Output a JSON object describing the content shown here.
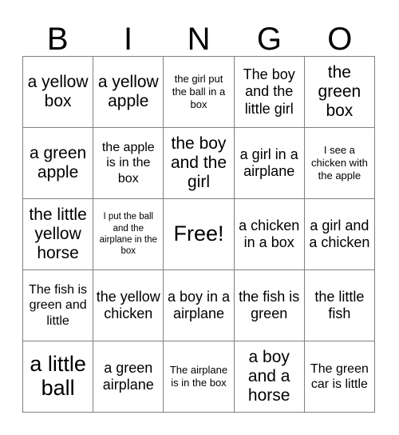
{
  "header": {
    "letters": [
      "B",
      "I",
      "N",
      "G",
      "O"
    ]
  },
  "grid": {
    "columns": 5,
    "rows": 5,
    "border_color": "#808080",
    "background_color": "#ffffff",
    "text_color": "#000000",
    "cells": [
      {
        "text": "a yellow box",
        "size": "xl",
        "free": false
      },
      {
        "text": "a yellow apple",
        "size": "xl",
        "free": false
      },
      {
        "text": "the girl put the ball in a box",
        "size": "sm",
        "free": false
      },
      {
        "text": "The boy and the little girl",
        "size": "lg",
        "free": false
      },
      {
        "text": "the green box",
        "size": "xl",
        "free": false
      },
      {
        "text": "a green apple",
        "size": "xl",
        "free": false
      },
      {
        "text": "the apple is in the box",
        "size": "md",
        "free": false
      },
      {
        "text": "the boy and the girl",
        "size": "xl",
        "free": false
      },
      {
        "text": "a girl in a airplane",
        "size": "lg",
        "free": false
      },
      {
        "text": "I see a chicken with the apple",
        "size": "sm",
        "free": false
      },
      {
        "text": "the little yellow horse",
        "size": "xl",
        "free": false
      },
      {
        "text": "I put the ball and the airplane in the box",
        "size": "xs",
        "free": false
      },
      {
        "text": "Free!",
        "size": "xxl",
        "free": true
      },
      {
        "text": "a chicken in a box",
        "size": "lg",
        "free": false
      },
      {
        "text": "a girl and a chicken",
        "size": "lg",
        "free": false
      },
      {
        "text": "The fish is green and little",
        "size": "md",
        "free": false
      },
      {
        "text": "the yellow chicken",
        "size": "lg",
        "free": false
      },
      {
        "text": "a boy in a airplane",
        "size": "lg",
        "free": false
      },
      {
        "text": "the fish is green",
        "size": "lg",
        "free": false
      },
      {
        "text": "the little fish",
        "size": "lg",
        "free": false
      },
      {
        "text": "a little ball",
        "size": "xxl",
        "free": false
      },
      {
        "text": "a green airplane",
        "size": "lg",
        "free": false
      },
      {
        "text": "The airplane is in the box",
        "size": "sm",
        "free": false
      },
      {
        "text": "a boy and a horse",
        "size": "xl",
        "free": false
      },
      {
        "text": "The green car is little",
        "size": "md",
        "free": false
      }
    ]
  }
}
